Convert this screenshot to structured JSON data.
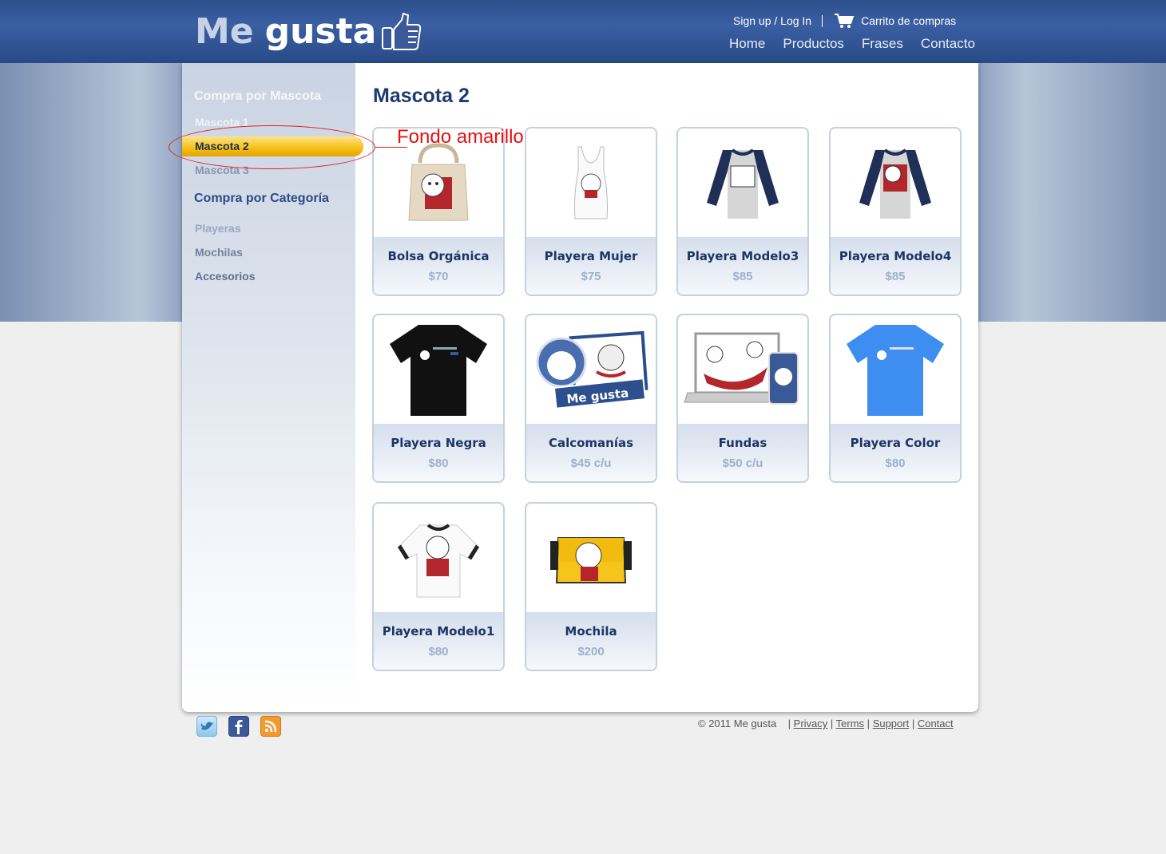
{
  "header": {
    "logo_me": "Me",
    "logo_gusta": "gusta",
    "signup": "Sign up / Log In",
    "cart": "Carrito de compras",
    "nav": [
      "Home",
      "Productos",
      "Frases",
      "Contacto"
    ]
  },
  "sidebar": {
    "heading_mascota": "Compra por Mascota",
    "mascotas": [
      "Mascota 1",
      "Mascota 2",
      "Mascota 3"
    ],
    "selected": "Mascota 2",
    "heading_categoria": "Compra por Categoría",
    "categorias": [
      "Playeras",
      "Mochilas",
      "Accesorios"
    ]
  },
  "page_title": "Mascota 2",
  "products": [
    {
      "name": "Bolsa Orgánica",
      "price": "$70"
    },
    {
      "name": "Playera Mujer",
      "price": "$75"
    },
    {
      "name": "Playera Modelo3",
      "price": "$85"
    },
    {
      "name": "Playera Modelo4",
      "price": "$85"
    },
    {
      "name": "Playera Negra",
      "price": "$80"
    },
    {
      "name": "Calcomanías",
      "price": "$45 c/u"
    },
    {
      "name": "Fundas",
      "price": "$50 c/u"
    },
    {
      "name": "Playera Color",
      "price": "$80"
    },
    {
      "name": "Playera Modelo1",
      "price": "$80"
    },
    {
      "name": "Mochila",
      "price": "$200"
    }
  ],
  "annotation": "Fondo amarillo",
  "footer": {
    "copyright": "© 2011   Me gusta",
    "links": [
      "Privacy",
      "Terms",
      "Support",
      "Contact"
    ],
    "social_icons": [
      "twitter-icon",
      "facebook-icon",
      "rss-icon"
    ]
  },
  "colors": {
    "header_blue": "#2d4f8e",
    "highlight_yellow": "#f7c21a",
    "annotation_red": "#e02020",
    "title_blue": "#1f3a6e"
  }
}
